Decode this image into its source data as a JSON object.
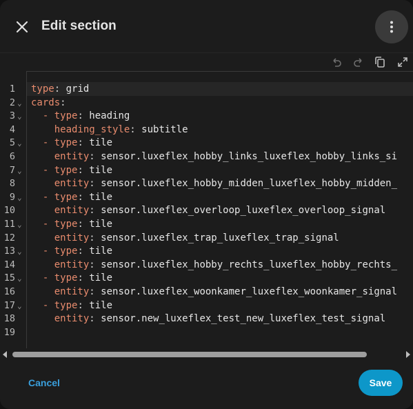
{
  "dialog": {
    "title": "Edit section",
    "close_icon": "close-icon",
    "menu_icon": "more-vertical-icon"
  },
  "toolbar": {
    "undo_icon": "undo-icon",
    "redo_icon": "redo-icon",
    "copy_icon": "copy-icon",
    "fullscreen_icon": "fullscreen-icon"
  },
  "editor": {
    "lines": [
      {
        "n": "1",
        "fold": false,
        "indent": "",
        "dash": false,
        "key": "type",
        "value": "grid"
      },
      {
        "n": "2",
        "fold": true,
        "indent": "",
        "dash": false,
        "key": "cards",
        "value": ""
      },
      {
        "n": "3",
        "fold": true,
        "indent": "  ",
        "dash": true,
        "key": "type",
        "value": "heading"
      },
      {
        "n": "4",
        "fold": false,
        "indent": "    ",
        "dash": false,
        "key": "heading_style",
        "value": "subtitle"
      },
      {
        "n": "5",
        "fold": true,
        "indent": "  ",
        "dash": true,
        "key": "type",
        "value": "tile"
      },
      {
        "n": "6",
        "fold": false,
        "indent": "    ",
        "dash": false,
        "key": "entity",
        "value": "sensor.luxeflex_hobby_links_luxeflex_hobby_links_si"
      },
      {
        "n": "7",
        "fold": true,
        "indent": "  ",
        "dash": true,
        "key": "type",
        "value": "tile"
      },
      {
        "n": "8",
        "fold": false,
        "indent": "    ",
        "dash": false,
        "key": "entity",
        "value": "sensor.luxeflex_hobby_midden_luxeflex_hobby_midden_"
      },
      {
        "n": "9",
        "fold": true,
        "indent": "  ",
        "dash": true,
        "key": "type",
        "value": "tile"
      },
      {
        "n": "10",
        "fold": false,
        "indent": "    ",
        "dash": false,
        "key": "entity",
        "value": "sensor.luxeflex_overloop_luxeflex_overloop_signal"
      },
      {
        "n": "11",
        "fold": true,
        "indent": "  ",
        "dash": true,
        "key": "type",
        "value": "tile"
      },
      {
        "n": "12",
        "fold": false,
        "indent": "    ",
        "dash": false,
        "key": "entity",
        "value": "sensor.luxeflex_trap_luxeflex_trap_signal"
      },
      {
        "n": "13",
        "fold": true,
        "indent": "  ",
        "dash": true,
        "key": "type",
        "value": "tile"
      },
      {
        "n": "14",
        "fold": false,
        "indent": "    ",
        "dash": false,
        "key": "entity",
        "value": "sensor.luxeflex_hobby_rechts_luxeflex_hobby_rechts_"
      },
      {
        "n": "15",
        "fold": true,
        "indent": "  ",
        "dash": true,
        "key": "type",
        "value": "tile"
      },
      {
        "n": "16",
        "fold": false,
        "indent": "    ",
        "dash": false,
        "key": "entity",
        "value": "sensor.luxeflex_woonkamer_luxeflex_woonkamer_signal"
      },
      {
        "n": "17",
        "fold": true,
        "indent": "  ",
        "dash": true,
        "key": "type",
        "value": "tile"
      },
      {
        "n": "18",
        "fold": false,
        "indent": "    ",
        "dash": false,
        "key": "entity",
        "value": "sensor.new_luxeflex_test_new_luxeflex_test_signal"
      },
      {
        "n": "19",
        "fold": false,
        "indent": "",
        "dash": false,
        "key": "",
        "value": ""
      }
    ]
  },
  "footer": {
    "cancel_label": "Cancel",
    "save_label": "Save"
  },
  "colors": {
    "accent": "#0d97c9",
    "key": "#e98c6e",
    "link": "#3a9fdc"
  }
}
